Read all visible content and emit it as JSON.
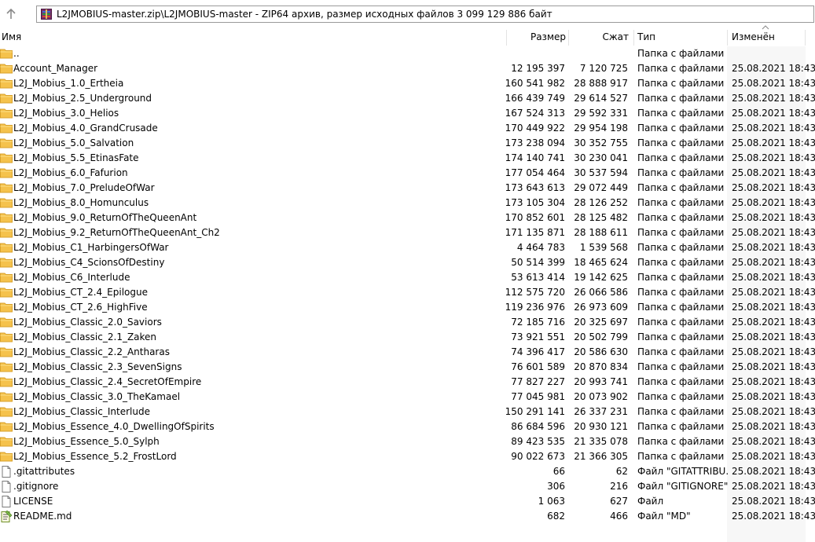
{
  "address": {
    "path": "L2JMOBIUS-master.zip\\L2JMOBIUS-master - ZIP64 архив, размер исходных файлов 3 099 129 886 байт"
  },
  "columns": {
    "name": "Имя",
    "size": "Размер",
    "packed": "Сжат",
    "type": "Тип",
    "modified": "Изменён"
  },
  "sorted_column_color": "#f7f7f7",
  "rows": [
    {
      "icon": "folder-icon",
      "name": "..",
      "size": "",
      "packed": "",
      "type": "Папка с файлами",
      "modified": ""
    },
    {
      "icon": "folder-icon",
      "name": "Account_Manager",
      "size": "12 195 397",
      "packed": "7 120 725",
      "type": "Папка с файлами",
      "modified": "25.08.2021 18:43"
    },
    {
      "icon": "folder-icon",
      "name": "L2J_Mobius_1.0_Ertheia",
      "size": "160 541 982",
      "packed": "28 888 917",
      "type": "Папка с файлами",
      "modified": "25.08.2021 18:43"
    },
    {
      "icon": "folder-icon",
      "name": "L2J_Mobius_2.5_Underground",
      "size": "166 439 749",
      "packed": "29 614 527",
      "type": "Папка с файлами",
      "modified": "25.08.2021 18:43"
    },
    {
      "icon": "folder-icon",
      "name": "L2J_Mobius_3.0_Helios",
      "size": "167 524 313",
      "packed": "29 592 331",
      "type": "Папка с файлами",
      "modified": "25.08.2021 18:43"
    },
    {
      "icon": "folder-icon",
      "name": "L2J_Mobius_4.0_GrandCrusade",
      "size": "170 449 922",
      "packed": "29 954 198",
      "type": "Папка с файлами",
      "modified": "25.08.2021 18:43"
    },
    {
      "icon": "folder-icon",
      "name": "L2J_Mobius_5.0_Salvation",
      "size": "173 238 094",
      "packed": "30 352 755",
      "type": "Папка с файлами",
      "modified": "25.08.2021 18:43"
    },
    {
      "icon": "folder-icon",
      "name": "L2J_Mobius_5.5_EtinasFate",
      "size": "174 140 741",
      "packed": "30 230 041",
      "type": "Папка с файлами",
      "modified": "25.08.2021 18:43"
    },
    {
      "icon": "folder-icon",
      "name": "L2J_Mobius_6.0_Fafurion",
      "size": "177 054 464",
      "packed": "30 537 594",
      "type": "Папка с файлами",
      "modified": "25.08.2021 18:43"
    },
    {
      "icon": "folder-icon",
      "name": "L2J_Mobius_7.0_PreludeOfWar",
      "size": "173 643 613",
      "packed": "29 072 449",
      "type": "Папка с файлами",
      "modified": "25.08.2021 18:43"
    },
    {
      "icon": "folder-icon",
      "name": "L2J_Mobius_8.0_Homunculus",
      "size": "173 105 304",
      "packed": "28 126 252",
      "type": "Папка с файлами",
      "modified": "25.08.2021 18:43"
    },
    {
      "icon": "folder-icon",
      "name": "L2J_Mobius_9.0_ReturnOfTheQueenAnt",
      "size": "170 852 601",
      "packed": "28 125 482",
      "type": "Папка с файлами",
      "modified": "25.08.2021 18:43"
    },
    {
      "icon": "folder-icon",
      "name": "L2J_Mobius_9.2_ReturnOfTheQueenAnt_Ch2",
      "size": "171 135 871",
      "packed": "28 188 611",
      "type": "Папка с файлами",
      "modified": "25.08.2021 18:43"
    },
    {
      "icon": "folder-icon",
      "name": "L2J_Mobius_C1_HarbingersOfWar",
      "size": "4 464 783",
      "packed": "1 539 568",
      "type": "Папка с файлами",
      "modified": "25.08.2021 18:43"
    },
    {
      "icon": "folder-icon",
      "name": "L2J_Mobius_C4_ScionsOfDestiny",
      "size": "50 514 399",
      "packed": "18 465 624",
      "type": "Папка с файлами",
      "modified": "25.08.2021 18:43"
    },
    {
      "icon": "folder-icon",
      "name": "L2J_Mobius_C6_Interlude",
      "size": "53 613 414",
      "packed": "19 142 625",
      "type": "Папка с файлами",
      "modified": "25.08.2021 18:43"
    },
    {
      "icon": "folder-icon",
      "name": "L2J_Mobius_CT_2.4_Epilogue",
      "size": "112 575 720",
      "packed": "26 066 586",
      "type": "Папка с файлами",
      "modified": "25.08.2021 18:43"
    },
    {
      "icon": "folder-icon",
      "name": "L2J_Mobius_CT_2.6_HighFive",
      "size": "119 236 976",
      "packed": "26 973 609",
      "type": "Папка с файлами",
      "modified": "25.08.2021 18:43"
    },
    {
      "icon": "folder-icon",
      "name": "L2J_Mobius_Classic_2.0_Saviors",
      "size": "72 185 716",
      "packed": "20 325 697",
      "type": "Папка с файлами",
      "modified": "25.08.2021 18:43"
    },
    {
      "icon": "folder-icon",
      "name": "L2J_Mobius_Classic_2.1_Zaken",
      "size": "73 921 551",
      "packed": "20 502 799",
      "type": "Папка с файлами",
      "modified": "25.08.2021 18:43"
    },
    {
      "icon": "folder-icon",
      "name": "L2J_Mobius_Classic_2.2_Antharas",
      "size": "74 396 417",
      "packed": "20 586 630",
      "type": "Папка с файлами",
      "modified": "25.08.2021 18:43"
    },
    {
      "icon": "folder-icon",
      "name": "L2J_Mobius_Classic_2.3_SevenSigns",
      "size": "76 601 589",
      "packed": "20 870 834",
      "type": "Папка с файлами",
      "modified": "25.08.2021 18:43"
    },
    {
      "icon": "folder-icon",
      "name": "L2J_Mobius_Classic_2.4_SecretOfEmpire",
      "size": "77 827 227",
      "packed": "20 993 741",
      "type": "Папка с файлами",
      "modified": "25.08.2021 18:43"
    },
    {
      "icon": "folder-icon",
      "name": "L2J_Mobius_Classic_3.0_TheKamael",
      "size": "77 045 981",
      "packed": "20 073 902",
      "type": "Папка с файлами",
      "modified": "25.08.2021 18:43"
    },
    {
      "icon": "folder-icon",
      "name": "L2J_Mobius_Classic_Interlude",
      "size": "150 291 141",
      "packed": "26 337 231",
      "type": "Папка с файлами",
      "modified": "25.08.2021 18:43"
    },
    {
      "icon": "folder-icon",
      "name": "L2J_Mobius_Essence_4.0_DwellingOfSpirits",
      "size": "86 684 596",
      "packed": "20 930 121",
      "type": "Папка с файлами",
      "modified": "25.08.2021 18:43"
    },
    {
      "icon": "folder-icon",
      "name": "L2J_Mobius_Essence_5.0_Sylph",
      "size": "89 423 535",
      "packed": "21 335 078",
      "type": "Папка с файлами",
      "modified": "25.08.2021 18:43"
    },
    {
      "icon": "folder-icon",
      "name": "L2J_Mobius_Essence_5.2_FrostLord",
      "size": "90 022 673",
      "packed": "21 366 305",
      "type": "Папка с файлами",
      "modified": "25.08.2021 18:43"
    },
    {
      "icon": "file-icon",
      "name": ".gitattributes",
      "size": "66",
      "packed": "62",
      "type": "Файл \"GITATTRIBU...",
      "modified": "25.08.2021 18:43"
    },
    {
      "icon": "file-icon",
      "name": ".gitignore",
      "size": "306",
      "packed": "216",
      "type": "Файл \"GITIGNORE\"",
      "modified": "25.08.2021 18:43"
    },
    {
      "icon": "file-icon",
      "name": "LICENSE",
      "size": "1 063",
      "packed": "627",
      "type": "Файл",
      "modified": "25.08.2021 18:43"
    },
    {
      "icon": "text-file-icon",
      "name": "README.md",
      "size": "682",
      "packed": "466",
      "type": "Файл \"MD\"",
      "modified": "25.08.2021 18:43"
    }
  ]
}
